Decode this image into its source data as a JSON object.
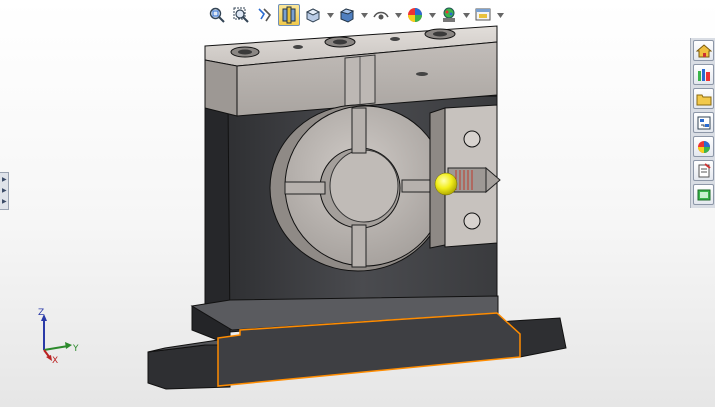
{
  "hud_toolbar": {
    "buttons": [
      {
        "icon": "zoom-to-fit-icon",
        "has_menu": false,
        "active": false
      },
      {
        "icon": "zoom-to-area-icon",
        "has_menu": false,
        "active": false
      },
      {
        "icon": "previous-view-icon",
        "has_menu": false,
        "active": false
      },
      {
        "icon": "section-view-icon",
        "has_menu": false,
        "active": true
      },
      {
        "icon": "view-orientation-icon",
        "has_menu": true,
        "active": false
      },
      {
        "icon": "display-style-icon",
        "has_menu": true,
        "active": false
      },
      {
        "icon": "hide-show-items-icon",
        "has_menu": true,
        "active": false
      },
      {
        "icon": "edit-appearance-icon",
        "has_menu": true,
        "active": false
      },
      {
        "icon": "apply-scene-icon",
        "has_menu": true,
        "active": false
      },
      {
        "icon": "view-settings-icon",
        "has_menu": true,
        "active": false
      }
    ]
  },
  "task_pane": {
    "tabs": [
      {
        "icon": "home-icon"
      },
      {
        "icon": "design-library-icon"
      },
      {
        "icon": "file-explorer-icon"
      },
      {
        "icon": "view-palette-icon"
      },
      {
        "icon": "appearances-icon"
      },
      {
        "icon": "custom-properties-icon"
      },
      {
        "icon": "recognizer-icon"
      }
    ]
  },
  "triad": {
    "x_label": "X",
    "y_label": "Y",
    "z_label": "Z"
  },
  "colors": {
    "face_light": "#c8c3bf",
    "face_dark": "#3f4043",
    "edge": "#111111",
    "highlight": "#ff8c00",
    "ball": "#f2ee1a"
  }
}
